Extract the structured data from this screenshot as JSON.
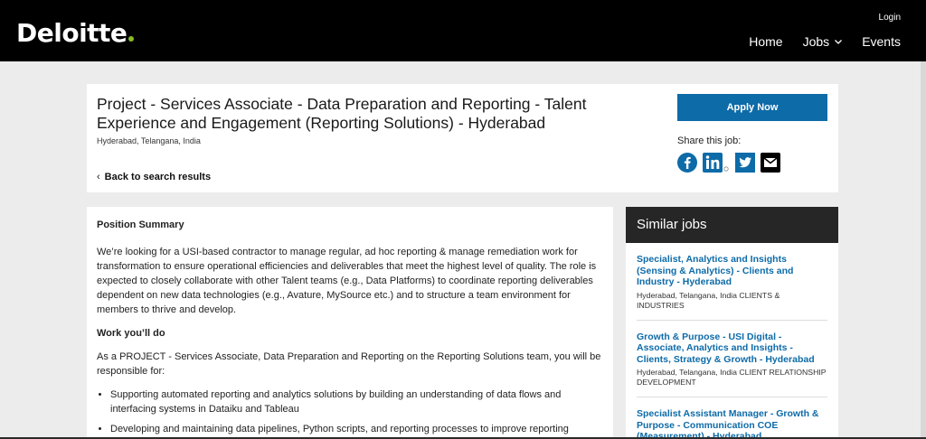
{
  "header": {
    "logo_text": "Deloitte",
    "login_label": "Login",
    "nav": [
      {
        "label": "Home"
      },
      {
        "label": "Jobs"
      },
      {
        "label": "Events"
      }
    ]
  },
  "job": {
    "title": "Project - Services Associate - Data Preparation and Reporting - Talent Experience and Engagement (Reporting Solutions) - Hyderabad",
    "location": "Hyderabad, Telangana, India",
    "back_label": "Back to search results",
    "apply_label": "Apply Now",
    "share_label": "Share this job:"
  },
  "description": {
    "heading_summary": "Position Summary",
    "summary_text": "We’re looking for a USI-based contractor to manage regular, ad hoc reporting & manage remediation work for transformation to ensure operational efficiencies and deliverables that meet the highest level of quality. The role is expected to closely collaborate with other Talent teams (e.g., Data Platforms) to coordinate reporting deliverables dependent on new data technologies (e.g., Avature, MySource etc.) and to structure a team environment for members to thrive and develop.",
    "heading_work": "Work you’ll do",
    "work_intro": "As a PROJECT - Services Associate, Data Preparation and Reporting on the Reporting Solutions team, you will be responsible for:",
    "bullets": [
      "Supporting automated reporting and analytics solutions by building an understanding of data flows and interfacing systems in Dataiku and Tableau",
      "Developing and maintaining data pipelines, Python scripts, and reporting processes to improve reporting efficiency"
    ]
  },
  "similar": {
    "heading": "Similar jobs",
    "jobs": [
      {
        "title": "Specialist, Analytics and Insights (Sensing & Analytics) - Clients and Industry - Hyderabad",
        "meta": "Hyderabad, Telangana, India CLIENTS & INDUSTRIES"
      },
      {
        "title": "Growth & Purpose - USI Digital - Associate, Analytics and Insights - Clients, Strategy & Growth - Hyderabad",
        "meta": "Hyderabad, Telangana, India CLIENT RELATIONSHIP DEVELOPMENT"
      },
      {
        "title": "Specialist Assistant Manager - Growth & Purpose - Communication COE (Measurement) - Hyderabad",
        "meta": ""
      }
    ]
  },
  "colors": {
    "accent": "#0d6ba8",
    "brand_dot": "#86bc25",
    "header_bg": "#000000",
    "similar_head_bg": "#262626"
  },
  "icons": [
    "chevron-down-icon",
    "chevron-left-icon",
    "facebook-icon",
    "linkedin-icon",
    "twitter-icon",
    "email-icon"
  ]
}
